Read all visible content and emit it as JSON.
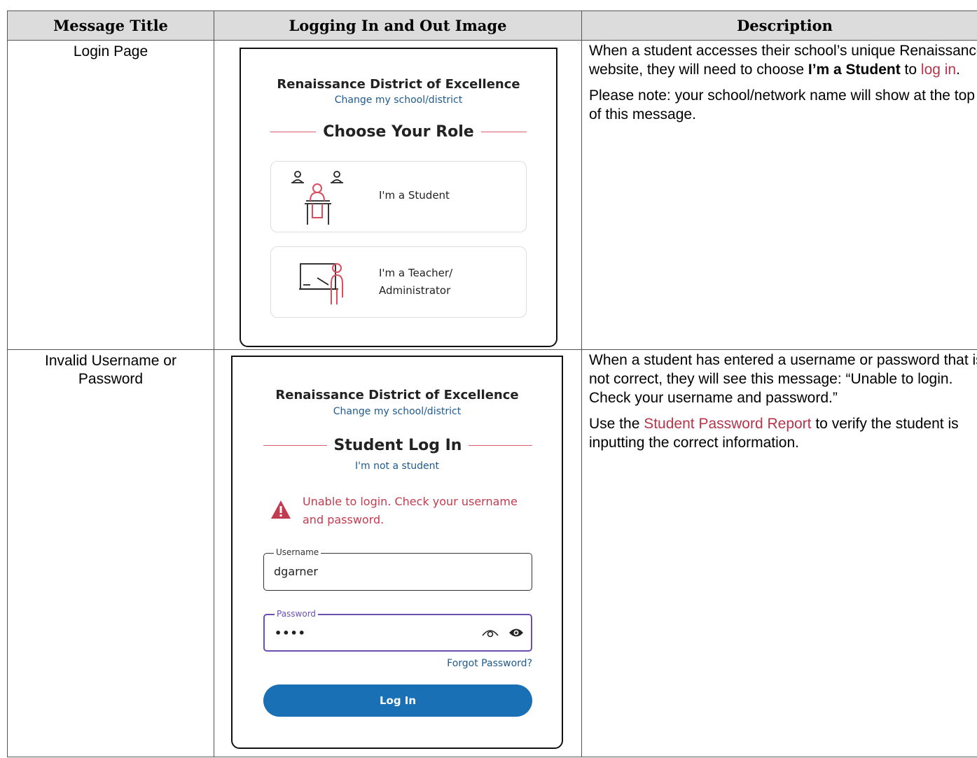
{
  "headers": {
    "col1": "Message Title",
    "col2": "Logging In and Out Image",
    "col3": "Description"
  },
  "rows": [
    {
      "title": "Login Page",
      "description": {
        "p1_prefix": "When a student accesses their school’s unique Renaissance website, they will need to choose ",
        "p1_bold": "I’m a Student",
        "p1_mid": " to ",
        "p1_link": "log in",
        "p1_suffix": ".",
        "p2": "Please note: your school/network name will show at the top of this message."
      },
      "screenshot": {
        "org_name": "Renaissance District of Excellence",
        "change_link": "Change my school/district",
        "heading": "Choose Your Role",
        "student_label": "I'm a Student",
        "teacher_label_1": "I'm a Teacher/",
        "teacher_label_2": "Administrator"
      }
    },
    {
      "title": "Invalid Username or Password",
      "description": {
        "p1": "When a student has entered a username or password that is not correct, they will see this message: “Unable to login. Check your username and password.”",
        "p2_prefix": "Use the ",
        "p2_link": "Student Password Report",
        "p2_suffix": " to verify the student is inputting the correct information."
      },
      "screenshot": {
        "org_name": "Renaissance District of Excellence",
        "change_link": "Change my school/district",
        "heading": "Student Log In",
        "not_student_link": "I'm not a student",
        "error_text": "Unable to login. Check your username and password.",
        "username_label": "Username",
        "username_value": "dgarner",
        "password_label": "Password",
        "password_value": "••••",
        "forgot_link": "Forgot Password?",
        "login_button": "Log In"
      }
    }
  ],
  "colors": {
    "accent_red": "#b5354a",
    "link_blue": "#1e5a8c",
    "button_blue": "#1970b4",
    "focus_purple": "#6a4fb0",
    "header_gray": "#dcdcdc"
  }
}
